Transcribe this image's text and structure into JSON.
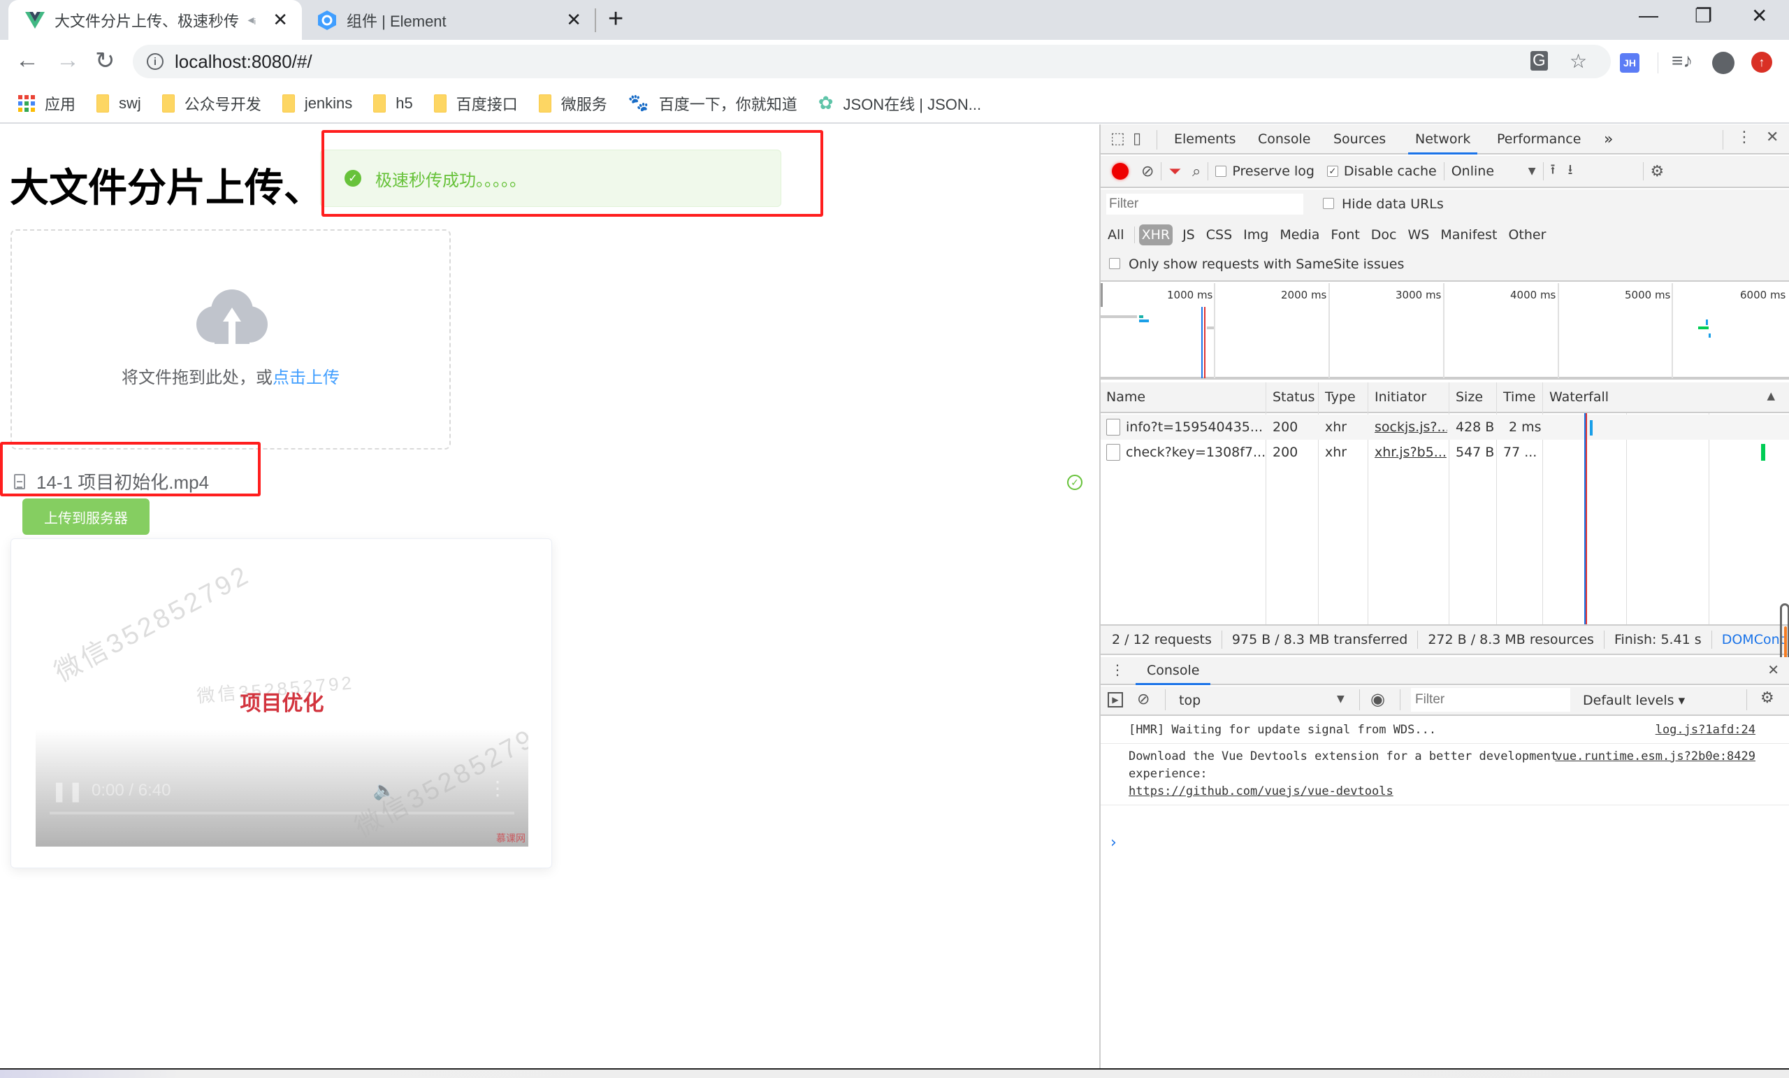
{
  "browser": {
    "tabs": [
      {
        "title": "大文件分片上传、极速秒传",
        "active": true,
        "favicon": "vue-logo-icon",
        "audio": true
      },
      {
        "title": "组件 | Element",
        "active": false,
        "favicon": "element-logo-icon"
      }
    ],
    "new_tab_label": "+",
    "window_controls": {
      "minimize": "—",
      "restore": "❐",
      "close": "✕"
    },
    "url": "localhost:8080/#/",
    "extensions": [
      "translate-icon",
      "bookmark-star-icon",
      "jh-extension-icon",
      "media-control-icon",
      "profile-avatar-icon",
      "update-icon"
    ],
    "jh_label": "JH",
    "bookmarks": [
      {
        "label": "应用",
        "icon": "apps-grid-icon"
      },
      {
        "label": "swj",
        "icon": "folder-icon"
      },
      {
        "label": "公众号开发",
        "icon": "folder-icon"
      },
      {
        "label": "jenkins",
        "icon": "folder-icon"
      },
      {
        "label": "h5",
        "icon": "folder-icon"
      },
      {
        "label": "百度接口",
        "icon": "folder-icon"
      },
      {
        "label": "微服务",
        "icon": "folder-icon"
      },
      {
        "label": "百度一下，你就知道",
        "icon": "baidu-paw-icon"
      },
      {
        "label": "JSON在线 | JSON...",
        "icon": "json-flower-icon"
      }
    ]
  },
  "page": {
    "heading": "大文件分片上传、",
    "toast": {
      "text": "极速秒传成功。。。。。",
      "type": "success"
    },
    "dropzone": {
      "text": "将文件拖到此处，或",
      "link": "点击上传"
    },
    "file": {
      "name": "14-1 项目初始化.mp4",
      "status": "success"
    },
    "upload_button": "上传到服务器",
    "video": {
      "title": "项目优化",
      "watermark": "微信352852792",
      "time": "0:00 / 6:40",
      "brand": "慕课网"
    }
  },
  "devtools": {
    "tabs": [
      "Elements",
      "Console",
      "Sources",
      "Network",
      "Performance"
    ],
    "active_tab": "Network",
    "more_tabs": "»",
    "network_toolbar": {
      "preserve_log": {
        "label": "Preserve log",
        "checked": false
      },
      "disable_cache": {
        "label": "Disable cache",
        "checked": true
      },
      "throttling": "Online"
    },
    "filter_placeholder": "Filter",
    "hide_data_urls": {
      "label": "Hide data URLs",
      "checked": false
    },
    "type_filters": [
      "All",
      "XHR",
      "JS",
      "CSS",
      "Img",
      "Media",
      "Font",
      "Doc",
      "WS",
      "Manifest",
      "Other"
    ],
    "selected_type": "XHR",
    "samesite": {
      "label": "Only show requests with SameSite issues",
      "checked": false
    },
    "overview_ticks": [
      "1000 ms",
      "2000 ms",
      "3000 ms",
      "4000 ms",
      "5000 ms",
      "6000 ms"
    ],
    "columns": [
      "Name",
      "Status",
      "Type",
      "Initiator",
      "Size",
      "Time",
      "Waterfall"
    ],
    "rows": [
      {
        "name": "info?t=159540435...",
        "status": "200",
        "type": "xhr",
        "initiator": "sockjs.js?...",
        "size": "428 B",
        "time": "2 ms"
      },
      {
        "name": "check?key=1308f7...",
        "status": "200",
        "type": "xhr",
        "initiator": "xhr.js?b5...",
        "size": "547 B",
        "time": "77 ..."
      }
    ],
    "summary": {
      "requests": "2 / 12 requests",
      "transferred": "975 B / 8.3 MB transferred",
      "resources": "272 B / 8.3 MB resources",
      "finish": "Finish: 5.41 s",
      "domcontent": "DOMCont"
    },
    "drawer": {
      "tab": "Console",
      "context": "top",
      "filter_placeholder": "Filter",
      "levels": "Default levels ▾",
      "messages": [
        {
          "text": "[HMR] Waiting for update signal from WDS...",
          "source": "log.js?1afd:24"
        },
        {
          "text": "Download the Vue Devtools extension for a better development experience:",
          "link": "https://github.com/vuejs/vue-devtools",
          "source": "vue.runtime.esm.js?2b0e:8429"
        }
      ],
      "prompt": "›"
    }
  }
}
